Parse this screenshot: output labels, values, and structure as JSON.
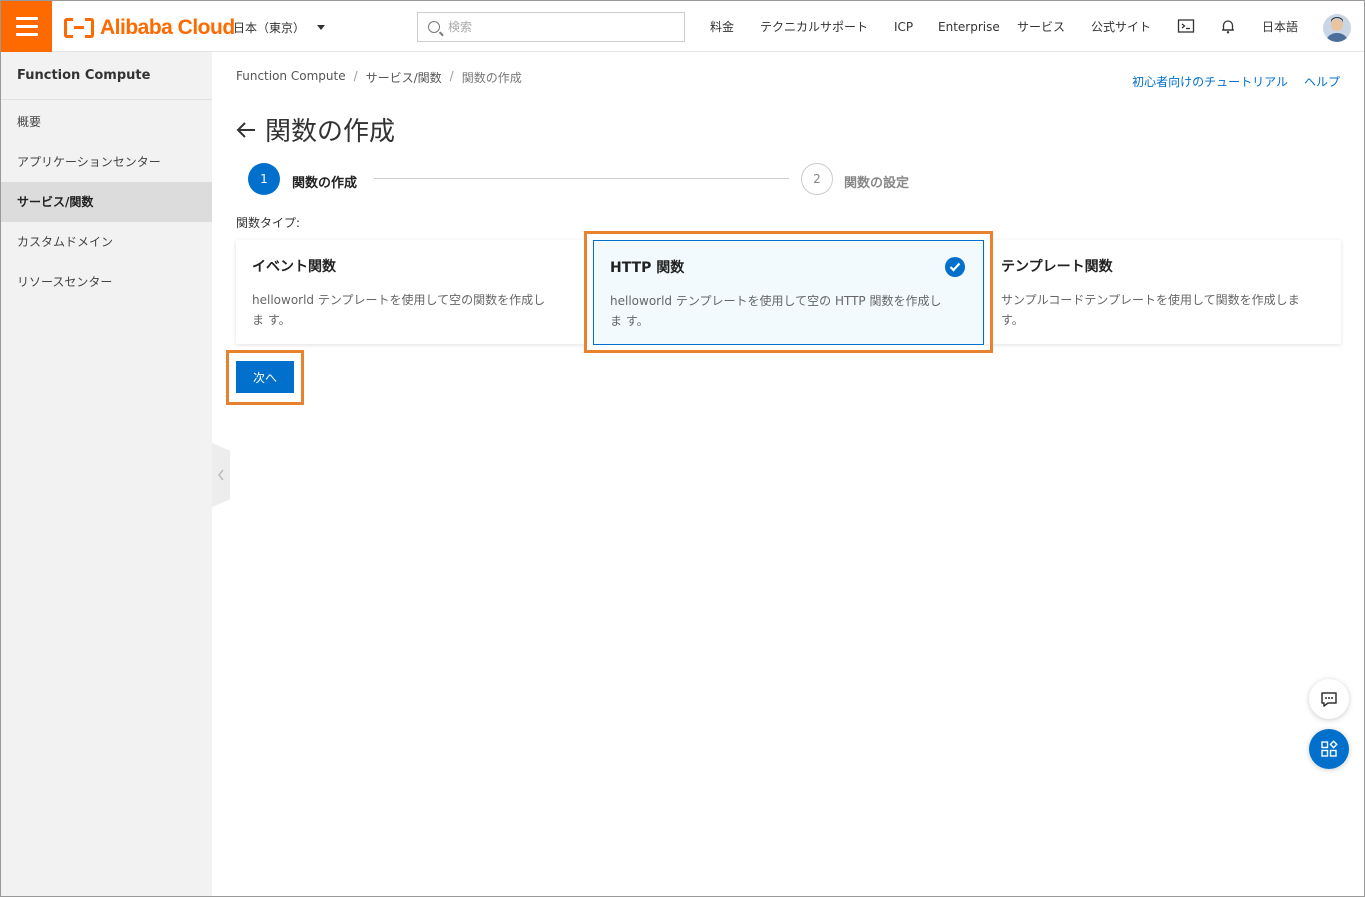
{
  "header": {
    "logo_text": "Alibaba Cloud",
    "region": "日本（東京）",
    "search_placeholder": "検索",
    "nav": [
      "料金",
      "テクニカルサポート",
      "ICP",
      "Enterprise",
      "サービス",
      "公式サイト"
    ],
    "language": "日本語",
    "accent_color": "#ff6a00"
  },
  "sidebar": {
    "title": "Function Compute",
    "items": [
      {
        "label": "概要"
      },
      {
        "label": "アプリケーションセンター"
      },
      {
        "label": "サービス/関数",
        "active": true
      },
      {
        "label": "カスタムドメイン"
      },
      {
        "label": "リソースセンター"
      }
    ]
  },
  "breadcrumb": [
    "Function Compute",
    "サービス/関数",
    "関数の作成"
  ],
  "help_links": [
    "初心者向けのチュートリアル",
    "ヘルプ"
  ],
  "page": {
    "title": "関数の作成",
    "steps": [
      {
        "number": "1",
        "label": "関数の作成",
        "state": "active"
      },
      {
        "number": "2",
        "label": "関数の設定",
        "state": "inactive"
      }
    ],
    "type_label": "関数タイプ:",
    "cards": [
      {
        "title": "イベント関数",
        "desc": "helloworld テンプレートを使用して空の関数を作成しま す。"
      },
      {
        "title": "HTTP 関数",
        "desc": "helloworld テンプレートを使用して空の HTTP 関数を作成しま す。",
        "selected": true
      },
      {
        "title": "テンプレート関数",
        "desc": "サンプルコードテンプレートを使用して関数を作成しま す。"
      }
    ],
    "next_button": "次へ"
  },
  "colors": {
    "primary": "#0070cc",
    "highlight": "#e8822e"
  }
}
